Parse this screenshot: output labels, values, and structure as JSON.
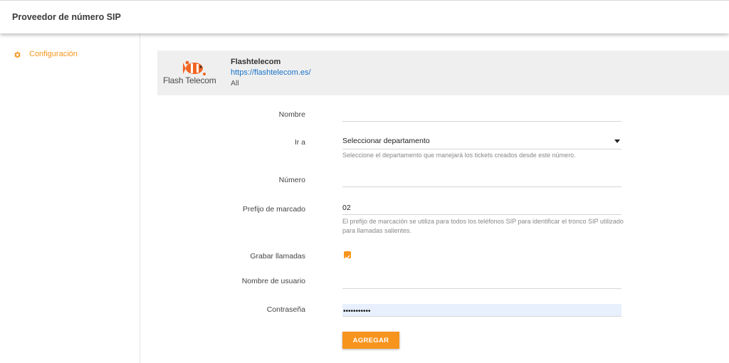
{
  "header": {
    "title": "Proveedor de número SIP"
  },
  "sidebar": {
    "items": [
      {
        "label": "Configuración",
        "icon": "gear-icon"
      }
    ]
  },
  "provider": {
    "logo_text": "Flash Telecom",
    "name": "Flashtelecom",
    "url": "https://flashtelecom.es/",
    "scope": "All"
  },
  "form": {
    "name": {
      "label": "Nombre",
      "value": ""
    },
    "goto": {
      "label": "Ir a",
      "selected": "Seleccionar departamento",
      "help": "Seleccione el departamento que manejará los tickets creados desde este número."
    },
    "number": {
      "label": "Número",
      "value": ""
    },
    "dial_prefix": {
      "label": "Prefijo de marcado",
      "value": "02",
      "help": "El prefijo de marcación se utiliza para todos los teléfonos SIP para identificar el tronco SIP utilizado para llamadas salientes."
    },
    "record_calls": {
      "label": "Grabar llamadas",
      "checked": true
    },
    "username": {
      "label": "Nombre de usuario",
      "value": ""
    },
    "password": {
      "label": "Contraseña",
      "value": "•••••••••••"
    },
    "submit_label": "AGREGAR"
  },
  "colors": {
    "accent": "#f7941d",
    "link": "#1a73c7",
    "card_bg": "#efefef",
    "autofill_bg": "#e8f0fe"
  }
}
